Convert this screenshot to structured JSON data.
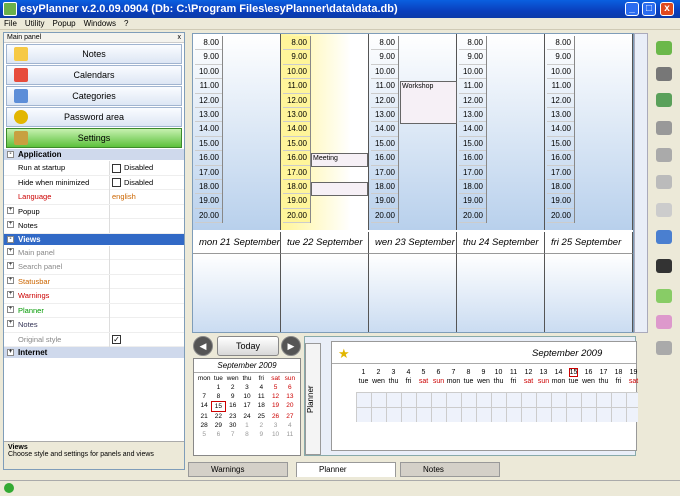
{
  "window": {
    "title": "esyPlanner v.2.0.09.0904 (Db: C:\\Program Files\\esyPlanner\\data\\data.db)",
    "min": "_",
    "max": "□",
    "close": "x"
  },
  "menu": [
    "File",
    "Utility",
    "Popup",
    "Windows",
    "?"
  ],
  "leftpanel": {
    "title": "Main panel",
    "close": "x",
    "nav": [
      {
        "label": "Notes"
      },
      {
        "label": "Calendars"
      },
      {
        "label": "Categories"
      },
      {
        "label": "Password area"
      },
      {
        "label": "Settings"
      }
    ],
    "groups": {
      "application": {
        "label": "Application",
        "rows": [
          {
            "k": "Run at startup",
            "v": "Disabled"
          },
          {
            "k": "Hide when minimized",
            "v": "Disabled"
          },
          {
            "k": "Language",
            "v": "english"
          }
        ],
        "sub": [
          "Popup",
          "Notes"
        ]
      },
      "views": {
        "label": "Views",
        "rows": [
          "Main panel",
          "Search panel",
          "Statusbar",
          "Warnings",
          "Planner",
          "Notes",
          "Original style"
        ]
      },
      "internet": {
        "label": "Internet"
      }
    },
    "desc_title": "Views",
    "desc_text": "Choose style and settings for panels and views"
  },
  "schedule": {
    "times": [
      "8.00",
      "9.00",
      "10.00",
      "11.00",
      "12.00",
      "13.00",
      "14.00",
      "15.00",
      "16.00",
      "17.00",
      "18.00",
      "19.00",
      "20.00"
    ],
    "days": [
      "mon 21 September",
      "tue 22 September",
      "wen 23 September",
      "thu 24 September",
      "fri 25 September"
    ],
    "events": {
      "meeting": "Meeting",
      "workshop": "Workshop"
    }
  },
  "nav": {
    "today": "Today",
    "prev": "◀",
    "next": "▶"
  },
  "minical": {
    "title": "September 2009",
    "weekdays": [
      "mon",
      "tue",
      "wen",
      "thu",
      "fri",
      "sat",
      "sun"
    ],
    "days": [
      "",
      "1",
      "2",
      "3",
      "4",
      "5",
      "6",
      "7",
      "8",
      "9",
      "10",
      "11",
      "12",
      "13",
      "14",
      "15",
      "16",
      "17",
      "18",
      "19",
      "20",
      "21",
      "22",
      "23",
      "24",
      "25",
      "26",
      "27",
      "28",
      "29",
      "30",
      "1",
      "2",
      "3",
      "4",
      "5",
      "6",
      "7",
      "8",
      "9",
      "10",
      "11"
    ]
  },
  "planner": {
    "tab": "Planner",
    "title": "September 2009",
    "days": [
      [
        "1",
        "tue"
      ],
      [
        "2",
        "wen"
      ],
      [
        "3",
        "thu"
      ],
      [
        "4",
        "fri"
      ],
      [
        "5",
        "sat"
      ],
      [
        "6",
        "sun"
      ],
      [
        "7",
        "mon"
      ],
      [
        "8",
        "tue"
      ],
      [
        "9",
        "wen"
      ],
      [
        "10",
        "thu"
      ],
      [
        "11",
        "fri"
      ],
      [
        "12",
        "sat"
      ],
      [
        "13",
        "sun"
      ],
      [
        "14",
        "mon"
      ],
      [
        "15",
        "tue"
      ],
      [
        "16",
        "wen"
      ],
      [
        "17",
        "thu"
      ],
      [
        "18",
        "fri"
      ],
      [
        "19",
        "sat"
      ]
    ]
  },
  "bottomtabs": [
    {
      "label": "Warnings"
    },
    {
      "label": "Planner"
    },
    {
      "label": "Notes"
    }
  ]
}
